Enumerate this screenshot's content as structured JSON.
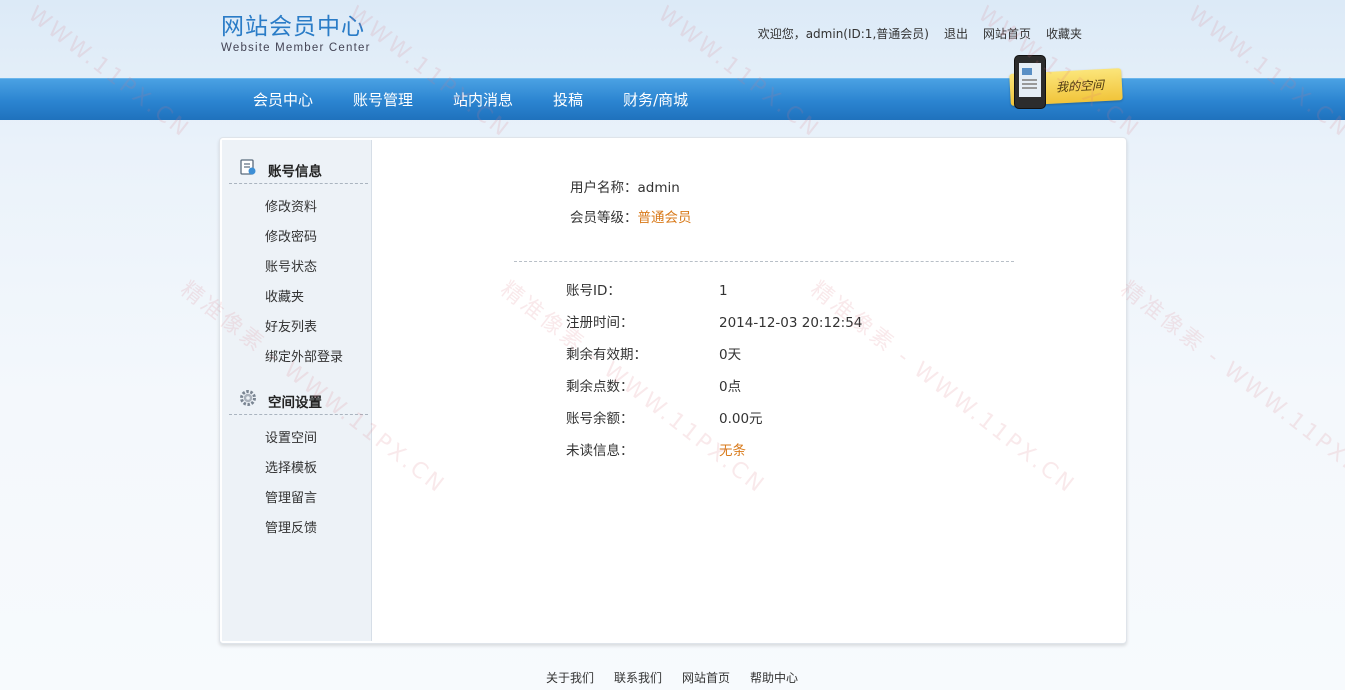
{
  "header": {
    "title": "网站会员中心",
    "subtitle": "Website Member Center",
    "welcome": "欢迎您，admin(ID:1,普通会员)",
    "links": [
      "退出",
      "网站首页",
      "收藏夹"
    ]
  },
  "nav": {
    "items": [
      "会员中心",
      "账号管理",
      "站内消息",
      "投稿",
      "财务/商城"
    ],
    "my_space": "我的空间"
  },
  "sidebar": {
    "account": {
      "title": "账号信息",
      "items": [
        "修改资料",
        "修改密码",
        "账号状态",
        "收藏夹",
        "好友列表",
        "绑定外部登录"
      ]
    },
    "space": {
      "title": "空间设置",
      "items": [
        "设置空间",
        "选择模板",
        "管理留言",
        "管理反馈"
      ]
    }
  },
  "user": {
    "name_label": "用户名称：",
    "name": "admin",
    "level_label": "会员等级：",
    "level": "普通会员"
  },
  "details": [
    {
      "label": "账号ID：",
      "value": "1"
    },
    {
      "label": "注册时间：",
      "value": "2014-12-03 20:12:54"
    },
    {
      "label": "剩余有效期：",
      "value": "0天"
    },
    {
      "label": "剩余点数：",
      "value": "0点"
    },
    {
      "label": "账号余额：",
      "value": "0.00元"
    },
    {
      "label": "未读信息：",
      "value": "无条"
    }
  ],
  "footer": [
    "关于我们",
    "联系我们",
    "网站首页",
    "帮助中心"
  ],
  "watermark": {
    "text1": "WWW.11PX.CN",
    "text2": "精准像素 - WWW.11PX.CN"
  },
  "colors": {
    "brand": "#2a7cc7",
    "nav": "#2b84d0",
    "highlight": "#d87a1a"
  }
}
